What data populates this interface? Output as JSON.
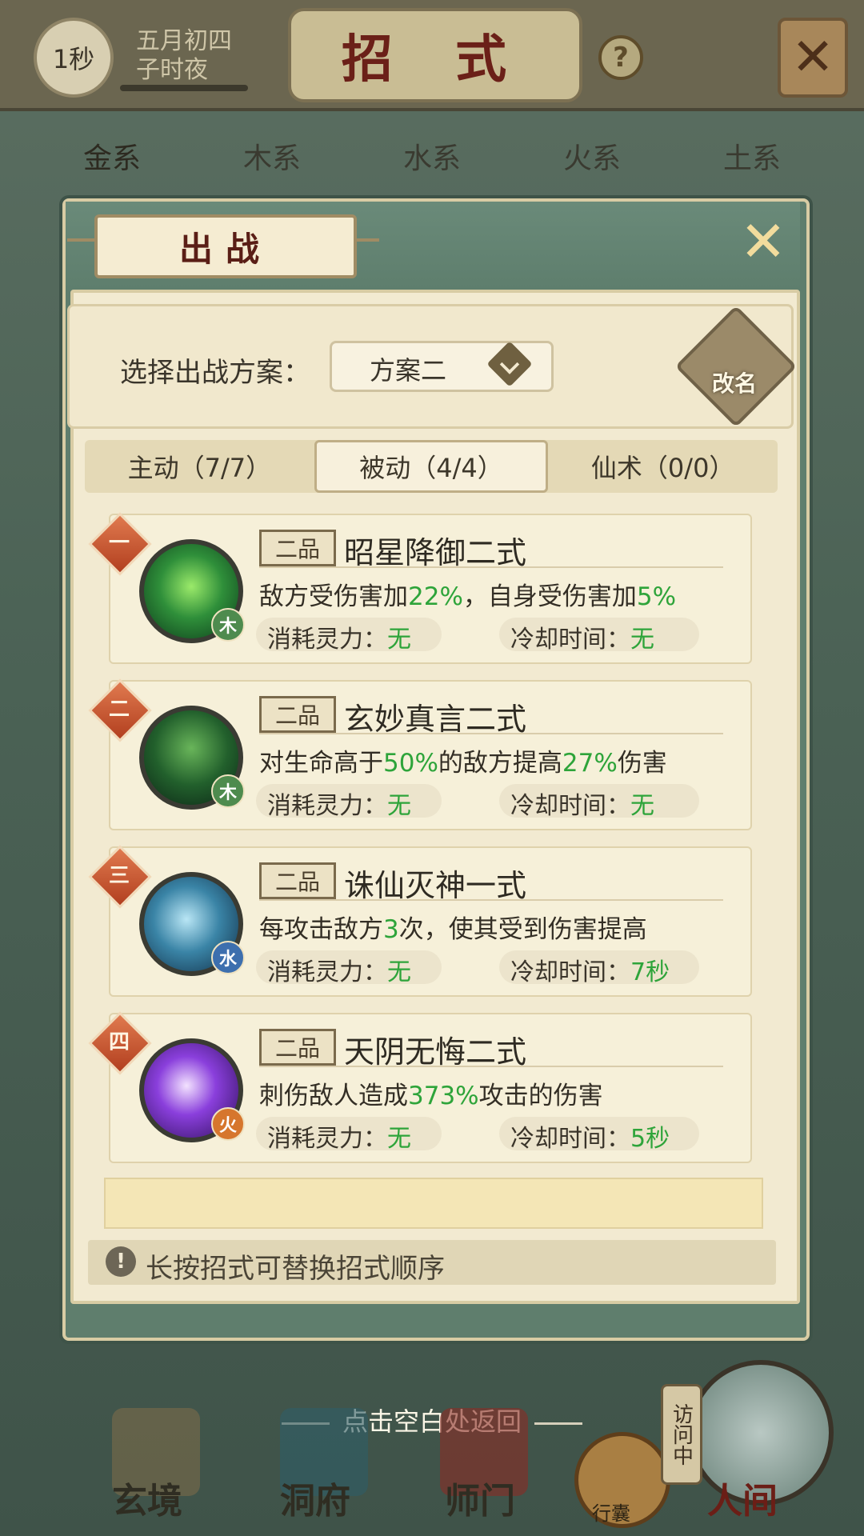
{
  "topbar": {
    "timer": "1秒",
    "date_line1": "五月初四",
    "date_line2": "子时夜",
    "title": "招 式",
    "help": "?",
    "close": "✕"
  },
  "element_tabs": [
    "金系",
    "木系",
    "水系",
    "火系",
    "土系"
  ],
  "modal": {
    "title": "出战",
    "close": "✕",
    "scheme_label": "选择出战方案：",
    "scheme_value": "方案二",
    "rename_label": "改名",
    "subtabs": [
      {
        "label": "主动（7/7）"
      },
      {
        "label": "被动（4/4）"
      },
      {
        "label": "仙术（0/0）"
      }
    ],
    "cards": [
      {
        "rank": "一",
        "element": "木",
        "grade": "二品",
        "name": "昭星降御二式",
        "desc_parts": [
          "敌方受伤害加",
          "22%",
          "，自身受伤害加",
          "5%"
        ],
        "cost_label": "消耗灵力：",
        "cost_value": "无",
        "cd_label": "冷却时间：",
        "cd_value": "无"
      },
      {
        "rank": "二",
        "element": "木",
        "grade": "二品",
        "name": "玄妙真言二式",
        "desc_parts": [
          "对生命高于",
          "50%",
          "的敌方提高",
          "27%",
          "伤害"
        ],
        "cost_label": "消耗灵力：",
        "cost_value": "无",
        "cd_label": "冷却时间：",
        "cd_value": "无"
      },
      {
        "rank": "三",
        "element": "水",
        "grade": "二品",
        "name": "诛仙灭神一式",
        "desc_parts": [
          "每攻击敌方",
          "3",
          "次，使其受到伤害提高"
        ],
        "cost_label": "消耗灵力：",
        "cost_value": "无",
        "cd_label": "冷却时间：",
        "cd_value": "7秒"
      },
      {
        "rank": "四",
        "element": "火",
        "grade": "二品",
        "name": "天阴无悔二式",
        "desc_parts": [
          "刺伤敌人造成",
          "373%",
          "攻击的伤害"
        ],
        "cost_label": "消耗灵力：",
        "cost_value": "无",
        "cd_label": "冷却时间：",
        "cd_value": "5秒"
      }
    ],
    "tip": "长按招式可替换招式顺序",
    "tip_icon": "!"
  },
  "return_hint": "点击空白处返回",
  "bottom_nav": {
    "items": [
      "玄境",
      "洞府",
      "师门",
      "人间"
    ],
    "bag_label": "行囊",
    "visit_label": "访问中"
  },
  "colors": {
    "accent_green": "#2ea43a",
    "title_red": "#6b2018",
    "panel_bg": "#f2ead1"
  }
}
